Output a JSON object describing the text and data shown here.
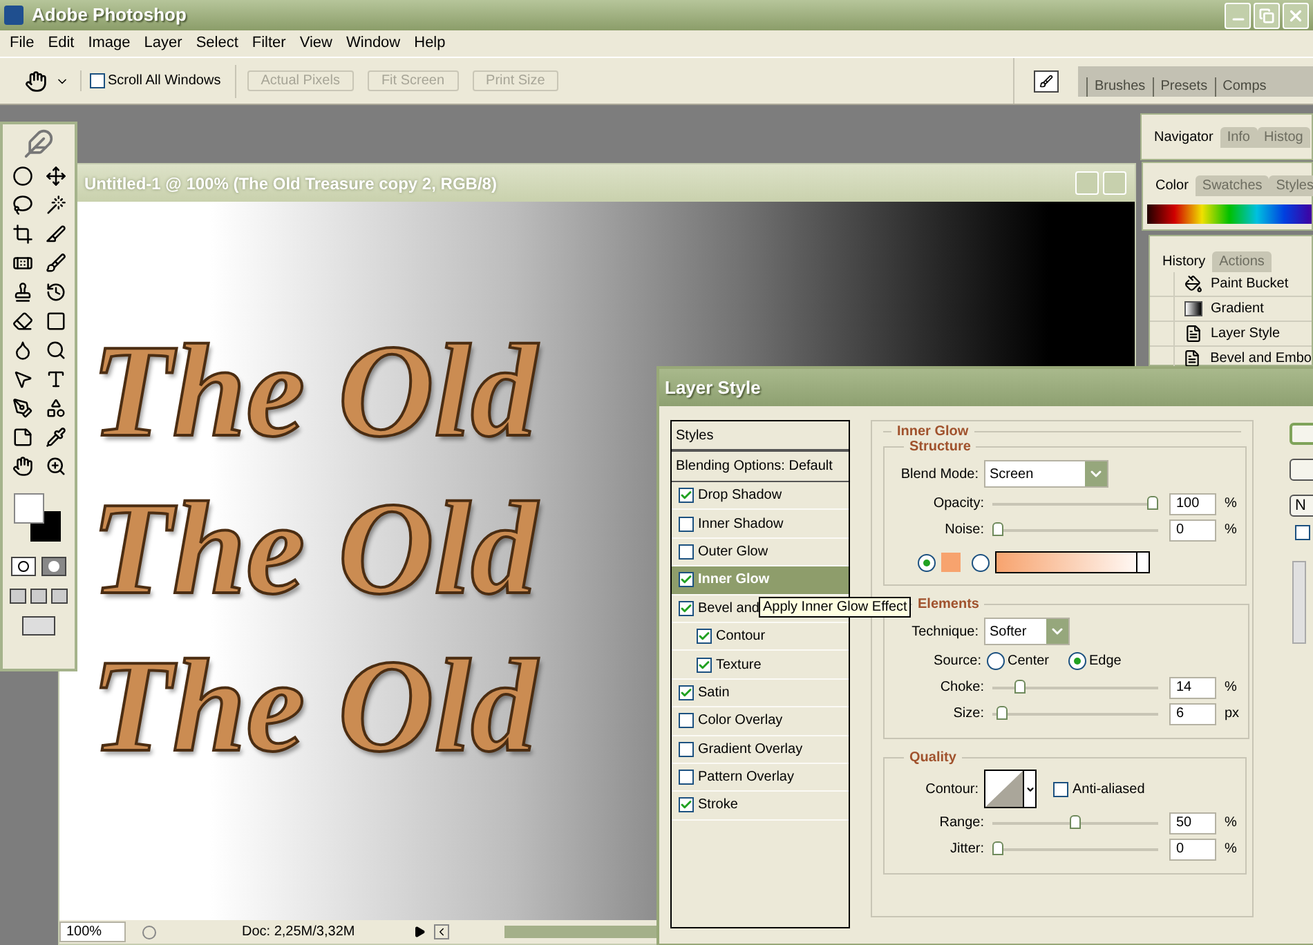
{
  "window": {
    "title": "Adobe Photoshop"
  },
  "menu": [
    "File",
    "Edit",
    "Image",
    "Layer",
    "Select",
    "Filter",
    "View",
    "Window",
    "Help"
  ],
  "options_bar": {
    "scroll_all": {
      "label": "Scroll All Windows",
      "checked": false
    },
    "buttons": [
      {
        "label": "Actual Pixels",
        "disabled": true
      },
      {
        "label": "Fit Screen",
        "disabled": true
      },
      {
        "label": "Print Size",
        "disabled": true
      }
    ]
  },
  "palette_well": [
    {
      "label": "Brushes"
    },
    {
      "label": "Presets"
    },
    {
      "label": "Comps"
    }
  ],
  "document": {
    "title": "Untitled-1 @ 100% (The Old Treasure copy 2, RGB/8)",
    "canvas_text": [
      "The Old",
      "The Old",
      "The Old"
    ],
    "zoom": "100%",
    "doc_size": "Doc: 2,25M/3,32M"
  },
  "panels": [
    {
      "kind": "navigator",
      "tabs": [
        {
          "label": "Navigator",
          "selected": true
        },
        {
          "label": "Info",
          "selected": false
        },
        {
          "label": "Histog",
          "selected": false
        }
      ]
    },
    {
      "kind": "color",
      "tabs": [
        {
          "label": "Color",
          "selected": true
        },
        {
          "label": "Swatches",
          "selected": false
        },
        {
          "label": "Styles",
          "selected": false
        }
      ]
    },
    {
      "kind": "history",
      "tabs": [
        {
          "label": "History",
          "selected": true
        },
        {
          "label": "Actions",
          "selected": false
        }
      ],
      "items": [
        {
          "label": "Paint Bucket",
          "kind": "bucket"
        },
        {
          "label": "Gradient",
          "kind": "gradient"
        },
        {
          "label": "Layer Style",
          "kind": "style"
        },
        {
          "label": "Bevel and Embo",
          "kind": "style"
        }
      ]
    }
  ],
  "layer_style": {
    "title": "Layer Style",
    "list_header": "Styles",
    "blending_options": "Blending Options: Default",
    "effects": [
      {
        "label": "Drop Shadow",
        "checked": true,
        "selected": false
      },
      {
        "label": "Inner Shadow",
        "checked": false,
        "selected": false
      },
      {
        "label": "Outer Glow",
        "checked": false,
        "selected": false
      },
      {
        "label": "Inner Glow",
        "checked": true,
        "selected": true
      },
      {
        "label": "Bevel and",
        "checked": true,
        "selected": false,
        "children": [
          {
            "label": "Contour",
            "checked": true,
            "selected": false
          },
          {
            "label": "Texture",
            "checked": true,
            "selected": false
          }
        ]
      },
      {
        "label": "Satin",
        "checked": true,
        "selected": false
      },
      {
        "label": "Color Overlay",
        "checked": false,
        "selected": false
      },
      {
        "label": "Gradient Overlay",
        "checked": false,
        "selected": false
      },
      {
        "label": "Pattern Overlay",
        "checked": false,
        "selected": false
      },
      {
        "label": "Stroke",
        "checked": true,
        "selected": false
      }
    ],
    "tooltip": "Apply Inner Glow Effect",
    "section_title": "Inner Glow",
    "structure": {
      "title": "Structure",
      "blend_mode": {
        "label": "Blend Mode:",
        "value": "Screen"
      },
      "sliders": [
        {
          "label": "Opacity:",
          "level": 1,
          "value": "100",
          "unit": "%"
        },
        {
          "label": "Noise:",
          "level": 0,
          "value": "0",
          "unit": "%"
        }
      ],
      "fill_options": [
        {
          "kind": "color",
          "selected": true,
          "color": "#f7a36e"
        },
        {
          "kind": "gradient",
          "selected": false,
          "color": "#f7a36e"
        }
      ]
    },
    "elements": {
      "title": "Elements",
      "technique": {
        "label": "Technique:",
        "value": "Softer"
      },
      "source": {
        "label": "Source:",
        "options": [
          {
            "label": "Center",
            "selected": false
          },
          {
            "label": "Edge",
            "selected": true
          }
        ]
      },
      "sliders": [
        {
          "label": "Choke:",
          "level": 0.14,
          "value": "14",
          "unit": "%"
        },
        {
          "label": "Size:",
          "level": 0.03,
          "value": "6",
          "unit": "px"
        }
      ]
    },
    "quality": {
      "title": "Quality",
      "contour_label": "Contour:",
      "anti_aliased": {
        "label": "Anti-aliased",
        "checked": false
      },
      "sliders": [
        {
          "label": "Range:",
          "level": 0.5,
          "value": "50",
          "unit": "%"
        },
        {
          "label": "Jitter:",
          "level": 0,
          "value": "0",
          "unit": "%"
        }
      ]
    },
    "new_style_button": "N",
    "preview_checkbox": {
      "checked": false
    }
  }
}
